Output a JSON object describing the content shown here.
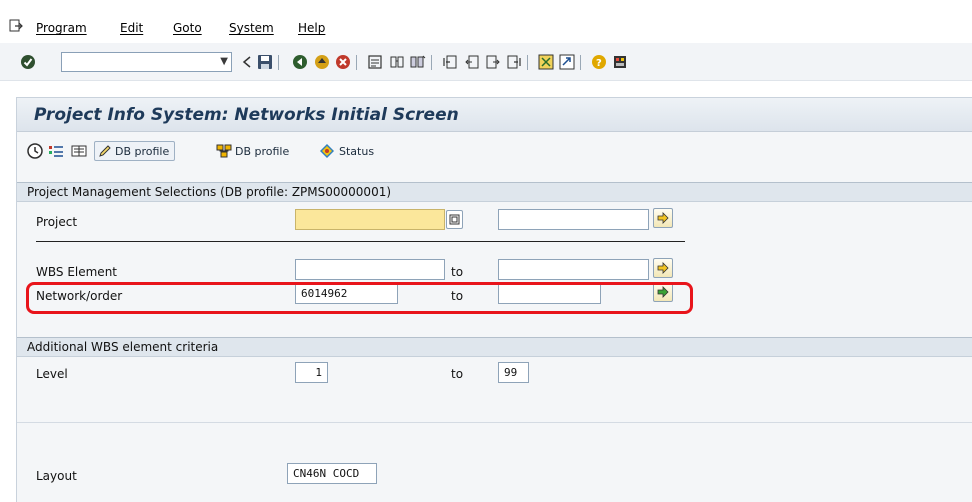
{
  "menu": {
    "items": [
      "Program",
      "Edit",
      "Goto",
      "System",
      "Help"
    ]
  },
  "toolbar": {
    "command_field_value": "",
    "icons": [
      "enter-icon",
      "back-icon",
      "save-icon",
      "back-green-icon",
      "exit-icon",
      "cancel-icon",
      "print-icon",
      "find-icon",
      "find-next-icon",
      "first-page-icon",
      "prev-page-icon",
      "next-page-icon",
      "last-page-icon",
      "new-session-icon",
      "shortcut-icon",
      "help-icon",
      "layout-menu-icon"
    ]
  },
  "page": {
    "title": "Project Info System: Networks Initial Screen"
  },
  "app_toolbar": {
    "db_profile_edit_label": "DB profile",
    "db_profile_label": "DB profile",
    "status_label": "Status"
  },
  "selections": {
    "header": "Project Management Selections (DB profile: ZPMS00000001)",
    "project": {
      "label": "Project",
      "from": "",
      "to": ""
    },
    "wbs": {
      "label": "WBS Element",
      "from": "",
      "to_label": "to",
      "to": ""
    },
    "network": {
      "label": "Network/order",
      "from": "6014962",
      "to_label": "to",
      "to": ""
    }
  },
  "additional": {
    "header": "Additional WBS element criteria",
    "level": {
      "label": "Level",
      "from": "1",
      "to_label": "to",
      "to": "99"
    }
  },
  "layout": {
    "label": "Layout",
    "value": "CN46N COCD"
  },
  "colors": {
    "required_field": "#fbe79b",
    "highlight": "#e8141b",
    "title_text": "#1e3a5a"
  }
}
